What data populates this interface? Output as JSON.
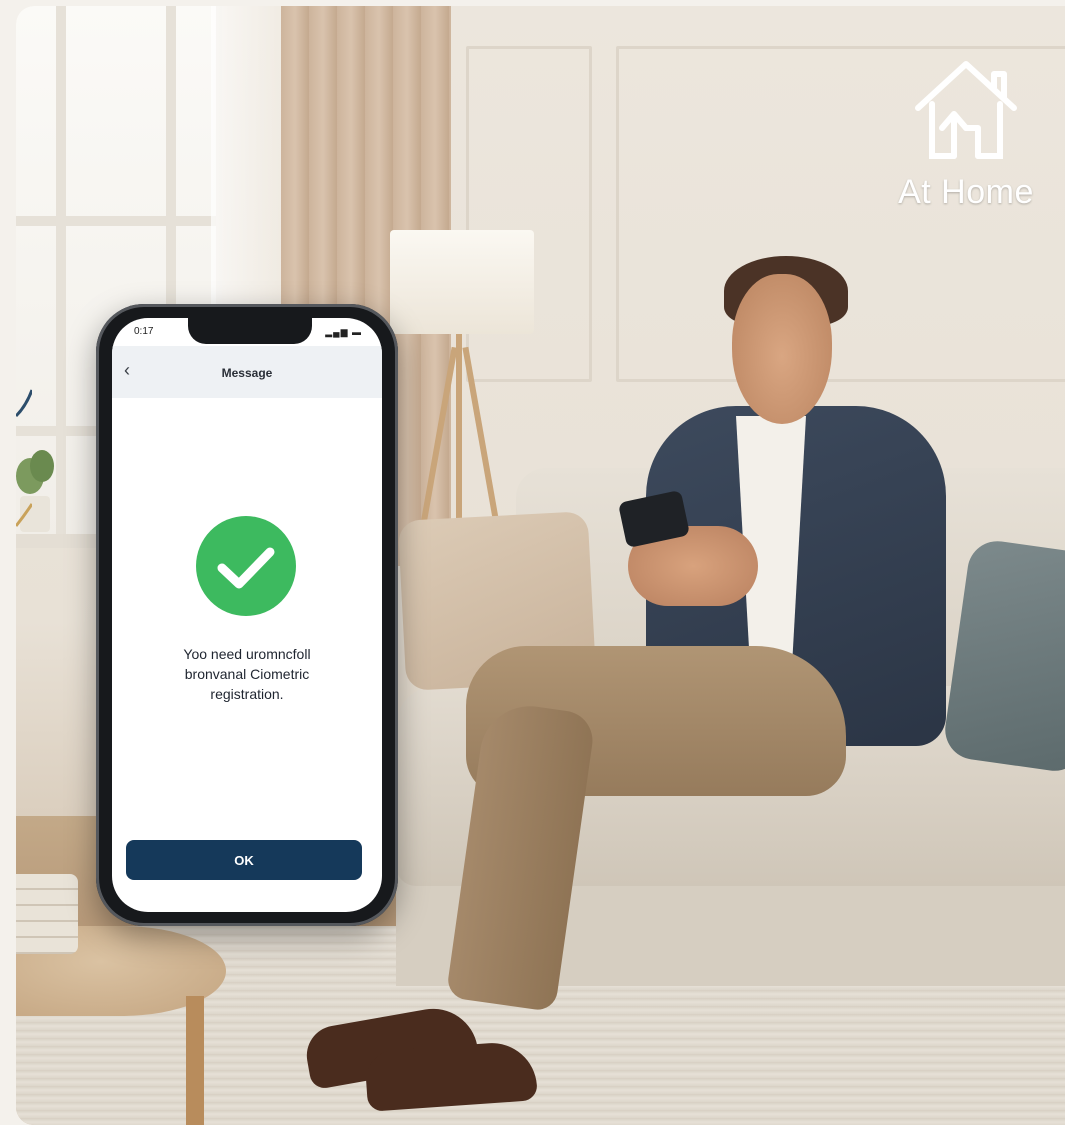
{
  "badge": {
    "icon": "house-arrow-icon",
    "label": "At Home"
  },
  "phone": {
    "status_time": "0:17",
    "status_icons": "▂▄▆ ▬",
    "nav_title": "Message",
    "back_symbol": "‹",
    "message": "Yoo need uromncfoll\nbronvanal Ciometric\nregistration.",
    "ok_label": "OK",
    "accent": "#15395a",
    "success_color": "#3dba5f"
  }
}
